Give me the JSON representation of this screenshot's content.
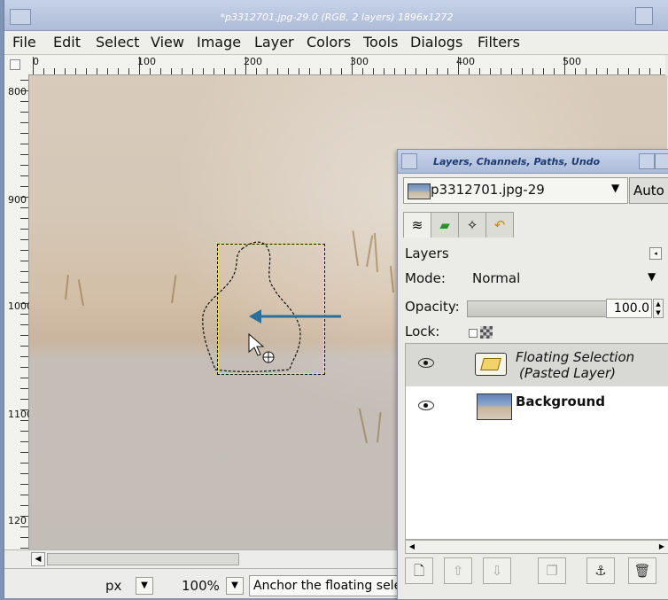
{
  "window": {
    "title": "*p3312701.jpg-29.0 (RGB, 2 layers) 1896x1272"
  },
  "menubar": {
    "items": [
      "File",
      "Edit",
      "Select",
      "View",
      "Image",
      "Layer",
      "Colors",
      "Tools",
      "Dialogs",
      "Filters"
    ]
  },
  "rulers": {
    "top_labels": [
      "0",
      "100",
      "200",
      "300",
      "400",
      "500"
    ],
    "left_labels": [
      "800",
      "900",
      "1000",
      "1100",
      "120"
    ]
  },
  "statusbar": {
    "unit": "px",
    "zoom": "100%",
    "message": "Anchor the floating selection"
  },
  "dock": {
    "title": "Layers, Channels, Paths, Undo",
    "image_name": "p3312701.jpg-29",
    "auto_label": "Auto",
    "section_label": "Layers",
    "mode_label": "Mode:",
    "mode_value": "Normal",
    "opacity_label": "Opacity:",
    "opacity_value": "100.0",
    "opacity_fraction": 1.0,
    "lock_label": "Lock:",
    "layers": [
      {
        "name_line1": "Floating Selection",
        "name_line2": "(Pasted Layer)",
        "selected": true,
        "visible": true
      },
      {
        "name": "Background",
        "selected": false,
        "visible": true
      }
    ]
  },
  "icons": {
    "tabs": [
      "layers-tab-icon",
      "channels-tab-icon",
      "paths-tab-icon",
      "undo-tab-icon"
    ],
    "toolbar": [
      "new-layer-icon",
      "raise-layer-icon",
      "lower-layer-icon",
      "duplicate-layer-icon",
      "anchor-layer-icon",
      "delete-layer-icon"
    ]
  },
  "colors": {
    "arrow": "#2a6f9a",
    "selection_dash": "#111111",
    "titlebar": "#b7c4de"
  }
}
